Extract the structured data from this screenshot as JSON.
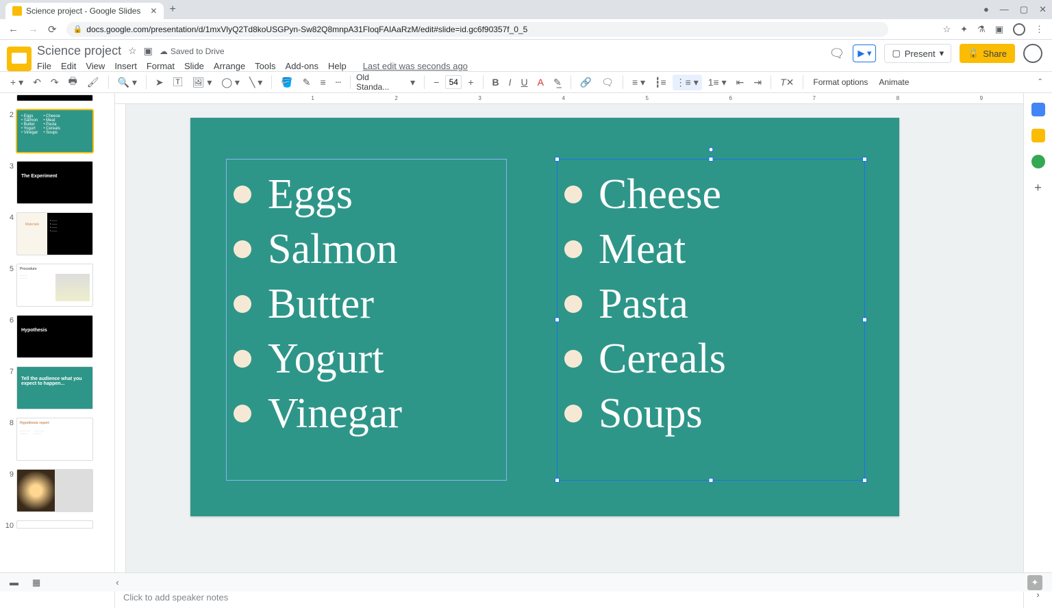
{
  "browser": {
    "tab_title": "Science project - Google Slides",
    "url": "docs.google.com/presentation/d/1mxVlyQ2Td8koUSGPyn-Sw82Q8mnpA31FloqFAIAaRzM/edit#slide=id.gc6f90357f_0_5"
  },
  "doc": {
    "title": "Science project",
    "saved": "Saved to Drive",
    "last_edit": "Last edit was seconds ago"
  },
  "menus": [
    "File",
    "Edit",
    "View",
    "Insert",
    "Format",
    "Slide",
    "Arrange",
    "Tools",
    "Add-ons",
    "Help"
  ],
  "toolbar": {
    "font": "Old Standa...",
    "size": "54",
    "format_options": "Format options",
    "animate": "Animate"
  },
  "buttons": {
    "present": "Present",
    "share": "Share"
  },
  "slide": {
    "left_items": [
      "Eggs",
      "Salmon",
      "Butter",
      "Yogurt",
      "Vinegar"
    ],
    "right_items": [
      "Cheese",
      "Meat",
      "Pasta",
      "Cereals",
      "Soups"
    ]
  },
  "thumbnails": {
    "items2_left": [
      "Eggs",
      "Salmon",
      "Butter",
      "Yogurt",
      "Vinegar"
    ],
    "items2_right": [
      "Cheese",
      "Meat",
      "Pasta",
      "Cereals",
      "Soups"
    ],
    "t3": "The Experiment",
    "t4l": "Materials",
    "t5": "Procedure",
    "t6": "Hypothesis",
    "t7": "Tell the audience what you expect to happen...",
    "t8": "Hypothesis report"
  },
  "notes": {
    "placeholder": "Click to add speaker notes"
  },
  "ruler": [
    " ",
    "1",
    "2",
    "3",
    "4",
    "5",
    "6",
    "7",
    "8",
    "9"
  ]
}
